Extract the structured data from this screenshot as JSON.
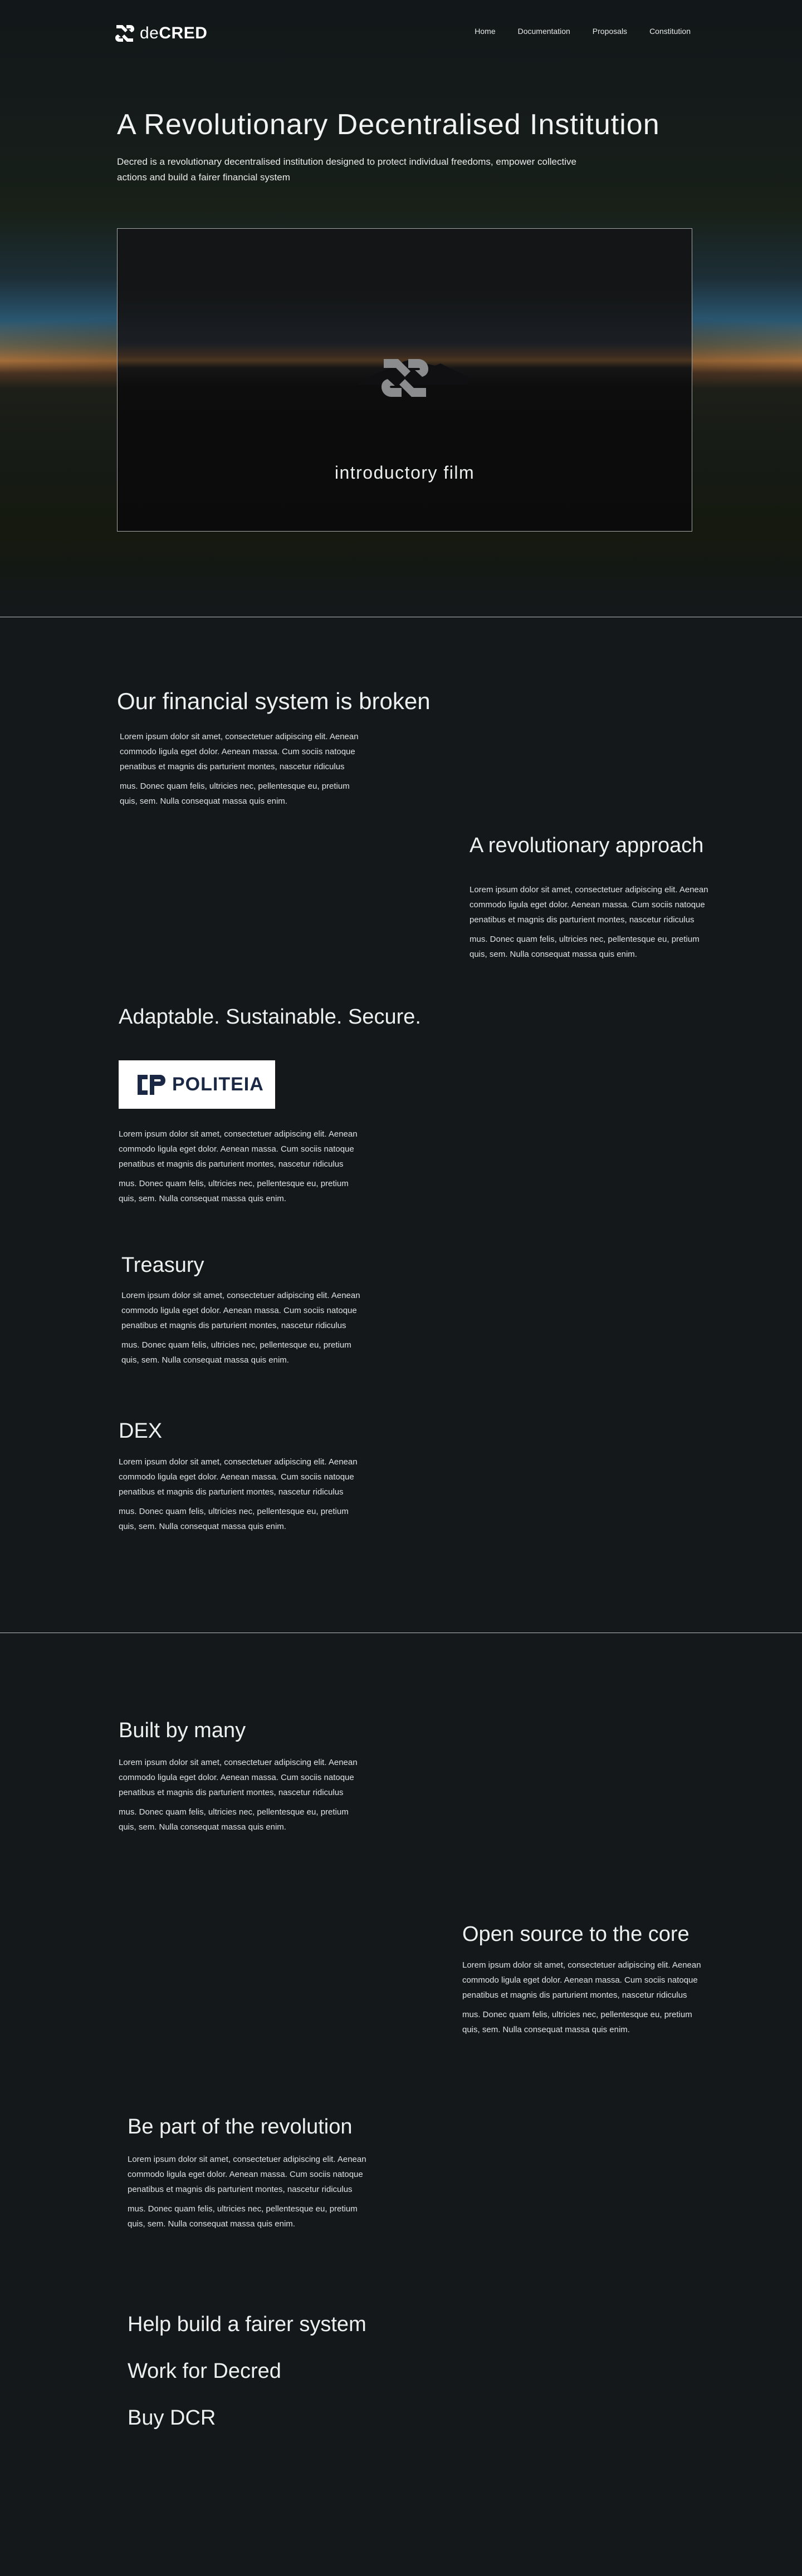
{
  "brand": {
    "name_prefix": "de",
    "name_suffix": "CRED"
  },
  "nav": [
    {
      "label": "Home"
    },
    {
      "label": "Documentation"
    },
    {
      "label": "Proposals"
    },
    {
      "label": "Constitution"
    }
  ],
  "hero": {
    "title": "A Revolutionary Decentralised Institution",
    "subtitle": "Decred is a revolutionary decentralised institution designed to protect individual freedoms, empower collective actions and build a fairer financial system",
    "video_label": "introductory film"
  },
  "lorem": {
    "p1": "Lorem ipsum dolor sit amet, consectetuer adipiscing elit. Aenean commodo ligula eget dolor. Aenean massa. Cum sociis natoque penatibus et magnis dis parturient montes, nascetur ridiculus",
    "p2": "mus. Donec quam felis, ultricies nec, pellentesque eu, pretium quis, sem. Nulla consequat massa quis enim."
  },
  "sections": {
    "broken": {
      "title": "Our financial system is broken"
    },
    "approach": {
      "title": "A revolutionary approach"
    },
    "adaptable": {
      "title": "Adaptable. Sustainable. Secure.",
      "logo_text": "POLITEIA"
    },
    "treasury": {
      "title": "Treasury"
    },
    "dex": {
      "title": "DEX"
    },
    "built": {
      "title": "Built by many"
    },
    "opensource": {
      "title": "Open source to the core"
    },
    "revolution": {
      "title": "Be part of the revolution"
    }
  },
  "ctas": [
    {
      "label": "Help build a fairer system"
    },
    {
      "label": "Work for Decred"
    },
    {
      "label": "Buy DCR"
    }
  ],
  "colors": {
    "background": "#14181b",
    "text": "#e9ecec",
    "politeia_navy": "#1b2845"
  }
}
